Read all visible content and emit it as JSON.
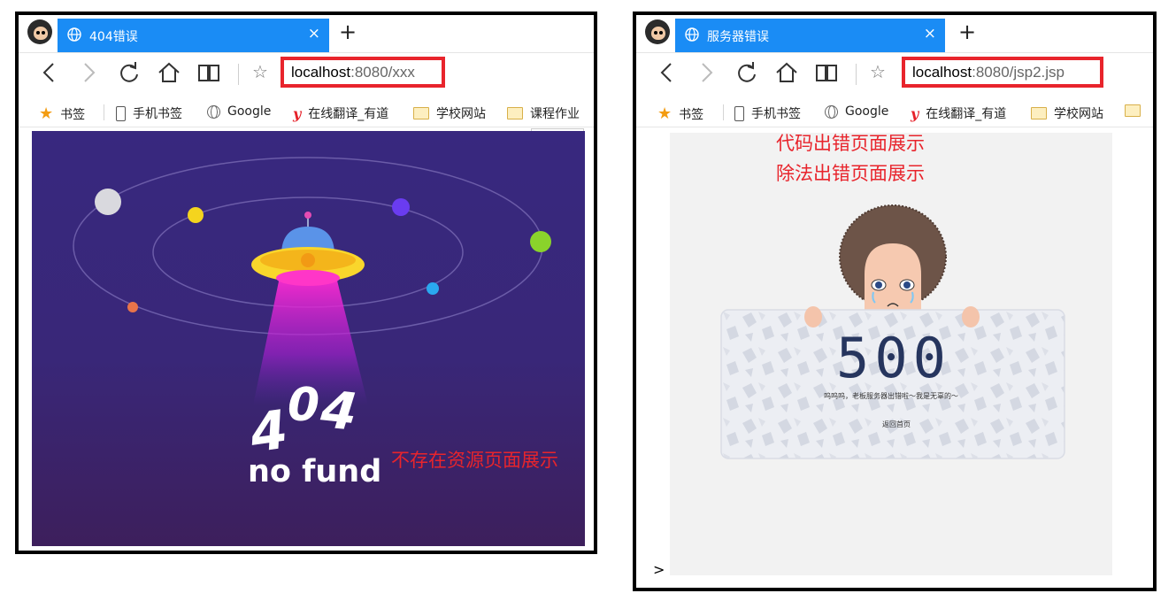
{
  "left_window": {
    "tab_title": "404错误",
    "tab_close": "×",
    "new_tab": "+",
    "url_host": "localhost",
    "url_rest": ":8080/xxx",
    "bookmarks": [
      "书签",
      "手机书签",
      "Google",
      "在线翻译_有道",
      "学校网站",
      "课程作业"
    ],
    "page": {
      "digits": [
        "4",
        "0",
        "4"
      ],
      "caption": "no fund",
      "annotation": "不存在资源页面展示"
    }
  },
  "right_window": {
    "tab_title": "服务器错误",
    "tab_close": "×",
    "new_tab": "+",
    "url_host": "localhost",
    "url_rest": ":8080/jsp2.jsp",
    "bookmarks": [
      "书签",
      "手机书签",
      "Google",
      "在线翻译_有道",
      "学校网站"
    ],
    "page": {
      "annotation_1": "代码出错页面展示",
      "annotation_2": "除法出错页面展示",
      "error_code": "500",
      "message": "呜呜呜，老板服务器出错啦～我是无辜的～",
      "home_link": "返回首页"
    },
    "console_prompt": ">"
  },
  "colors": {
    "tab_blue": "#1a8cf5",
    "annotation_red": "#e8242c",
    "space_bg": "#38287f",
    "error_code_navy": "#26355e"
  }
}
